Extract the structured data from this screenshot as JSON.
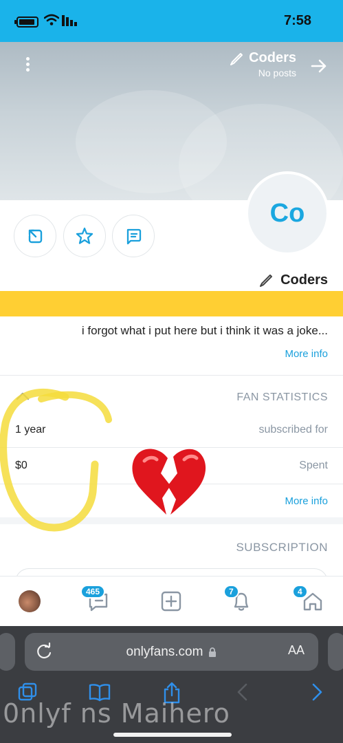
{
  "status": {
    "time": "7:58"
  },
  "cover": {
    "name": "Coders",
    "posts": "No posts"
  },
  "avatar": {
    "initials": "Co"
  },
  "profile": {
    "name": "Coders",
    "bio": "i forgot what i put here but i think it was a joke...",
    "more_info": "More info"
  },
  "fan_statistics": {
    "heading": "FAN STATISTICS",
    "rows": [
      {
        "label": "subscribed for",
        "value": "1 year"
      },
      {
        "label": "Spent",
        "value": "$0"
      }
    ],
    "more_info": "More info"
  },
  "subscription": {
    "heading": "SUBSCRIPTION"
  },
  "bottom_nav": {
    "messages_badge": "465",
    "notifications_badge": "7",
    "home_badge": "4"
  },
  "browser": {
    "url": "onlyfans.com",
    "text_size": "AA",
    "watermark": "0nlyf ns Maihero"
  },
  "colors": {
    "accent": "#1aa0dc",
    "status_bar": "#1ab3ea",
    "yellow_bar": "#ffcf33",
    "scribble": "#f5dc3c"
  }
}
